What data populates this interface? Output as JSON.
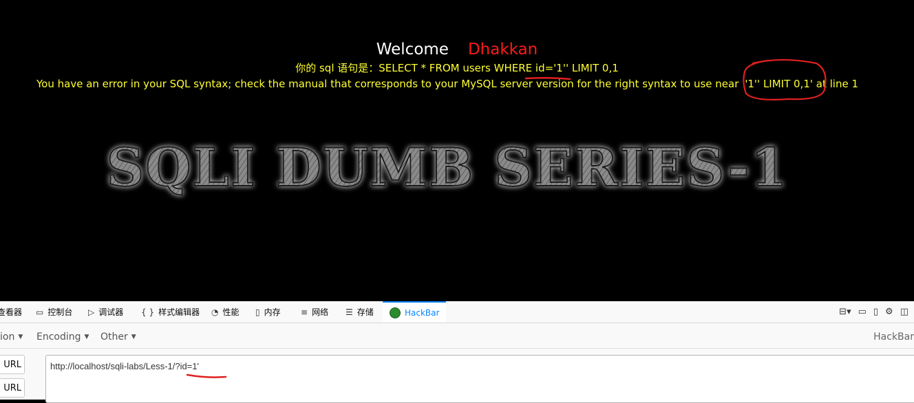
{
  "page": {
    "welcome": "Welcome",
    "username": "Dhakkan",
    "sql_prefix": "你的 sql 语句是：",
    "sql_statement": "SELECT * FROM users WHERE id='1'' LIMIT 0,1",
    "error_message": "You have an error in your SQL syntax; check the manual that corresponds to your MySQL server version for the right syntax to use near ''1'' LIMIT 0,1' at line 1",
    "banner": "SQLI DUMB SERIES-1"
  },
  "devtools": {
    "tabs": [
      {
        "label": "查看器",
        "icon": "inspector-icon"
      },
      {
        "label": "控制台",
        "icon": "console-icon"
      },
      {
        "label": "调试器",
        "icon": "debugger-icon"
      },
      {
        "label": "样式编辑器",
        "icon": "style-editor-icon"
      },
      {
        "label": "性能",
        "icon": "performance-icon"
      },
      {
        "label": "内存",
        "icon": "memory-icon"
      },
      {
        "label": "网络",
        "icon": "network-icon"
      },
      {
        "label": "存储",
        "icon": "storage-icon"
      },
      {
        "label": "HackBar",
        "icon": "hackbar-icon",
        "active": true
      }
    ],
    "right_icons": [
      "dock-layout-icon",
      "split-console-icon",
      "responsive-design-icon",
      "settings-gear-icon",
      "separate-window-icon"
    ]
  },
  "hackbar": {
    "menus": [
      "ion",
      "Encoding",
      "Other"
    ],
    "brand": "HackBar",
    "buttons": [
      "d URL",
      "URL"
    ],
    "url_value": "http://localhost/sqli-labs/Less-1/?id=1'"
  },
  "colors": {
    "page_bg": "#000000",
    "welcome": "#ffffff",
    "username": "#ff1a1a",
    "sql_text": "#ffff33",
    "annotation": "#e02020",
    "active_tab": "#0a84ff"
  }
}
